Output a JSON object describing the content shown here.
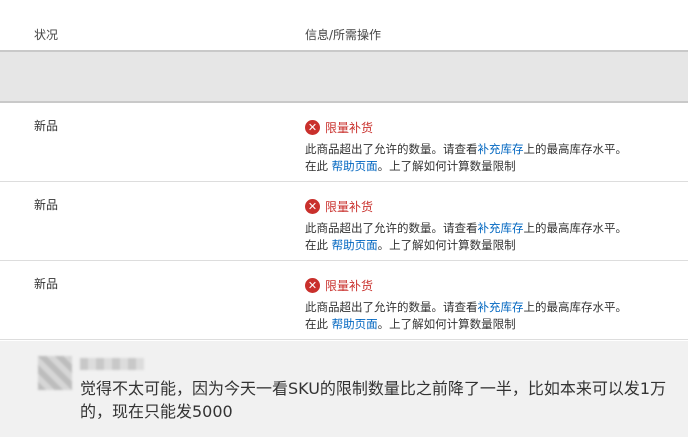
{
  "table": {
    "headers": {
      "status": "状况",
      "info": "信息/所需操作"
    },
    "rows": [
      {
        "status": "新品",
        "error_title": "限量补货",
        "msg_part1": "此商品超出了允许的数量。请查看",
        "msg_link1": "补充库存",
        "msg_part2": "上的最高库存水平。",
        "line2_prefix": "在此 ",
        "line2_link": "帮助页面",
        "line2_suffix": "。上了解如何计算数量限制"
      },
      {
        "status": "新品",
        "error_title": "限量补货",
        "msg_part1": "此商品超出了允许的数量。请查看",
        "msg_link1": "补充库存",
        "msg_part2": "上的最高库存水平。",
        "line2_prefix": "在此 ",
        "line2_link": "帮助页面",
        "line2_suffix": "。上了解如何计算数量限制"
      },
      {
        "status": "新品",
        "error_title": "限量补货",
        "msg_part1": "此商品超出了允许的数量。请查看",
        "msg_link1": "补充库存",
        "msg_part2": "上的最高库存水平。",
        "line2_prefix": "在此 ",
        "line2_link": "帮助页面",
        "line2_suffix": "。上了解如何计算数量限制"
      }
    ]
  },
  "icons": {
    "error": "error-x-circle-icon",
    "error_glyph": "✕"
  },
  "colors": {
    "error": "#c9302c",
    "link": "#0066c0",
    "band": "#e6e6e6",
    "chat_bg": "#f1f1f1"
  },
  "comment": {
    "text": "觉得不太可能，因为今天一看SKU的限制数量比之前降了一半，比如本来可以发1万的，现在只能发5000"
  }
}
